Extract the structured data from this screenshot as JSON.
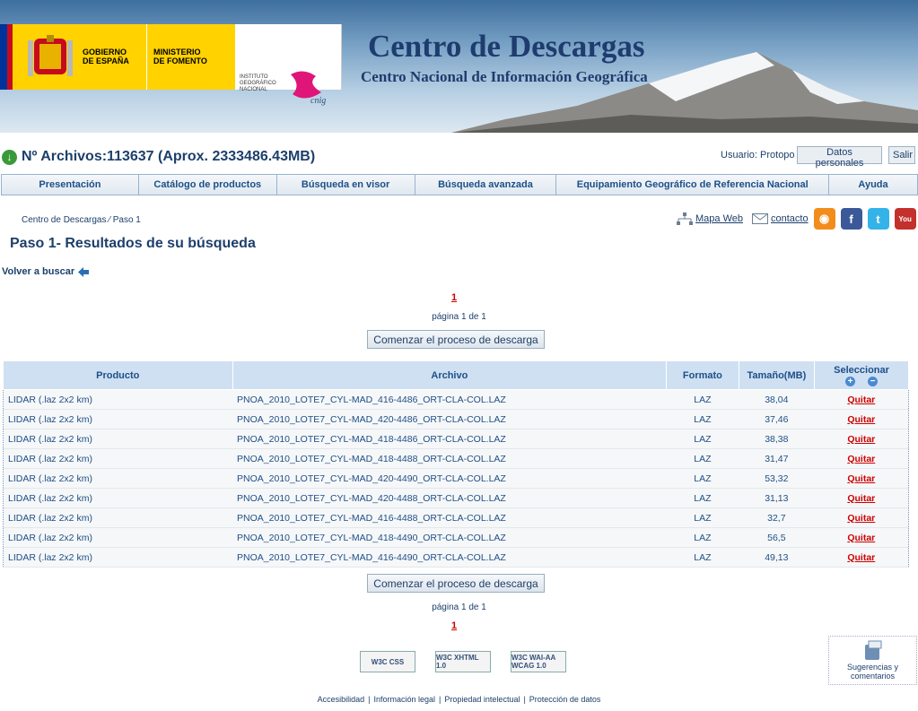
{
  "header": {
    "gov_line1": "GOBIERNO",
    "gov_line2": "DE ESPAÑA",
    "ministry_line1": "MINISTERIO",
    "ministry_line2": "DE FOMENTO",
    "institute_line1": "INSTITUTO",
    "institute_line2": "GEOGRÁFICO",
    "institute_line3": "NACIONAL",
    "cnig_logo": "cnig",
    "title": "Centro de Descargas",
    "subtitle": "Centro Nacional de Información Geográfica"
  },
  "status": {
    "files_label": "Nº Archivos:113637 (Aprox. 2333486.43MB)",
    "user_label": "Usuario: Protopo",
    "personal_data_button": "Datos personales",
    "logout_button": "Salir"
  },
  "nav": [
    "Presentación",
    "Catálogo de productos",
    "Búsqueda en visor",
    "Búsqueda avanzada",
    "Equipamiento Geográfico de Referencia Nacional",
    "Ayuda"
  ],
  "breadcrumb": "Centro de Descargas ⁄ Paso 1",
  "tools": {
    "sitemap": "Mapa Web",
    "contact": "contacto"
  },
  "page_title": "Paso 1- Resultados de su búsqueda",
  "back_link": "Volver a buscar",
  "pagination": {
    "page_link": "1",
    "info": "página 1 de 1"
  },
  "start_button": "Comenzar el proceso de descarga",
  "table": {
    "headers": {
      "producto": "Producto",
      "archivo": "Archivo",
      "formato": "Formato",
      "tamano": "Tamaño(MB)",
      "seleccionar": "Seleccionar"
    },
    "remove_label": "Quitar",
    "rows": [
      {
        "producto": "LIDAR (.laz 2x2 km)",
        "archivo": "PNOA_2010_LOTE7_CYL-MAD_416-4486_ORT-CLA-COL.LAZ",
        "formato": "LAZ",
        "tamano": "38,04"
      },
      {
        "producto": "LIDAR (.laz 2x2 km)",
        "archivo": "PNOA_2010_LOTE7_CYL-MAD_420-4486_ORT-CLA-COL.LAZ",
        "formato": "LAZ",
        "tamano": "37,46"
      },
      {
        "producto": "LIDAR (.laz 2x2 km)",
        "archivo": "PNOA_2010_LOTE7_CYL-MAD_418-4486_ORT-CLA-COL.LAZ",
        "formato": "LAZ",
        "tamano": "38,38"
      },
      {
        "producto": "LIDAR (.laz 2x2 km)",
        "archivo": "PNOA_2010_LOTE7_CYL-MAD_418-4488_ORT-CLA-COL.LAZ",
        "formato": "LAZ",
        "tamano": "31,47"
      },
      {
        "producto": "LIDAR (.laz 2x2 km)",
        "archivo": "PNOA_2010_LOTE7_CYL-MAD_420-4490_ORT-CLA-COL.LAZ",
        "formato": "LAZ",
        "tamano": "53,32"
      },
      {
        "producto": "LIDAR (.laz 2x2 km)",
        "archivo": "PNOA_2010_LOTE7_CYL-MAD_420-4488_ORT-CLA-COL.LAZ",
        "formato": "LAZ",
        "tamano": "31,13"
      },
      {
        "producto": "LIDAR (.laz 2x2 km)",
        "archivo": "PNOA_2010_LOTE7_CYL-MAD_416-4488_ORT-CLA-COL.LAZ",
        "formato": "LAZ",
        "tamano": "32,7"
      },
      {
        "producto": "LIDAR (.laz 2x2 km)",
        "archivo": "PNOA_2010_LOTE7_CYL-MAD_418-4490_ORT-CLA-COL.LAZ",
        "formato": "LAZ",
        "tamano": "56,5"
      },
      {
        "producto": "LIDAR (.laz 2x2 km)",
        "archivo": "PNOA_2010_LOTE7_CYL-MAD_416-4490_ORT-CLA-COL.LAZ",
        "formato": "LAZ",
        "tamano": "49,13"
      }
    ]
  },
  "badges": [
    "W3C CSS",
    "W3C XHTML 1.0",
    "W3C WAI-AA WCAG 1.0"
  ],
  "suggestions": {
    "line1": "Sugerencias y",
    "line2": "comentarios"
  },
  "footer": [
    "Accesibilidad",
    "Información legal",
    "Propiedad intelectual",
    "Protección de datos"
  ],
  "colors": {
    "accent": "#1d3f6b",
    "nav_text": "#1d4f88",
    "remove_link": "#cc0000",
    "header_bg": "#cfe0f2"
  }
}
